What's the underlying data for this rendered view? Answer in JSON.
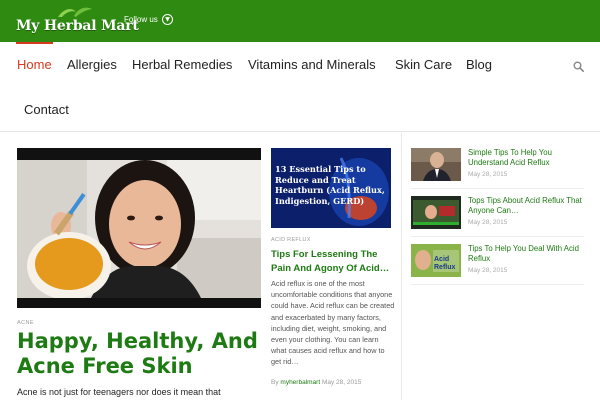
{
  "brand": {
    "logo_text": "My Herbal Mart",
    "follow_label": "Follow us",
    "accent_color": "#2f8a12",
    "title_color": "#1e7a12",
    "active_color": "#d93a1e"
  },
  "nav": {
    "items": [
      {
        "label": "Home",
        "active": true
      },
      {
        "label": "Allergies"
      },
      {
        "label": "Herbal Remedies"
      },
      {
        "label": "Vitamins and Minerals"
      },
      {
        "label": "Skin Care"
      },
      {
        "label": "Blog"
      },
      {
        "label": "Contact"
      }
    ],
    "search_icon": "search-icon"
  },
  "featured": {
    "category": "ACNE",
    "title": "Happy, Healthy, And Acne Free Skin",
    "excerpt": "Acne is not just for teenagers nor does it mean that"
  },
  "middle_post": {
    "image_text": "13 Essential Tips to Reduce and Treat Heartburn (Acid Reflux, Indigestion, GERD)",
    "category": "ACID REFLUX",
    "title": "Tips For Lessening The Pain And Agony Of Acid…",
    "excerpt": "Acid reflux is one of the most uncomfortable conditions that anyone could have. Acid reflux can be created and exacerbated by many factors, including diet, weight, smoking, and even your clothing. You can learn what causes acid reflux and how to get rid…",
    "by_label": "By",
    "author": "myherbalmart",
    "date": "May 28, 2015"
  },
  "sidebar": {
    "items": [
      {
        "title": "Simple Tips To Help You Understand Acid Reflux",
        "date": "May 28, 2015"
      },
      {
        "title": "Tops Tips About Acid Reflux That Anyone Can…",
        "date": "May 28, 2015"
      },
      {
        "title": "Tips To Help You Deal With Acid Reflux",
        "date": "May 28, 2015",
        "thumb_text": "Acid Reflux"
      }
    ]
  }
}
